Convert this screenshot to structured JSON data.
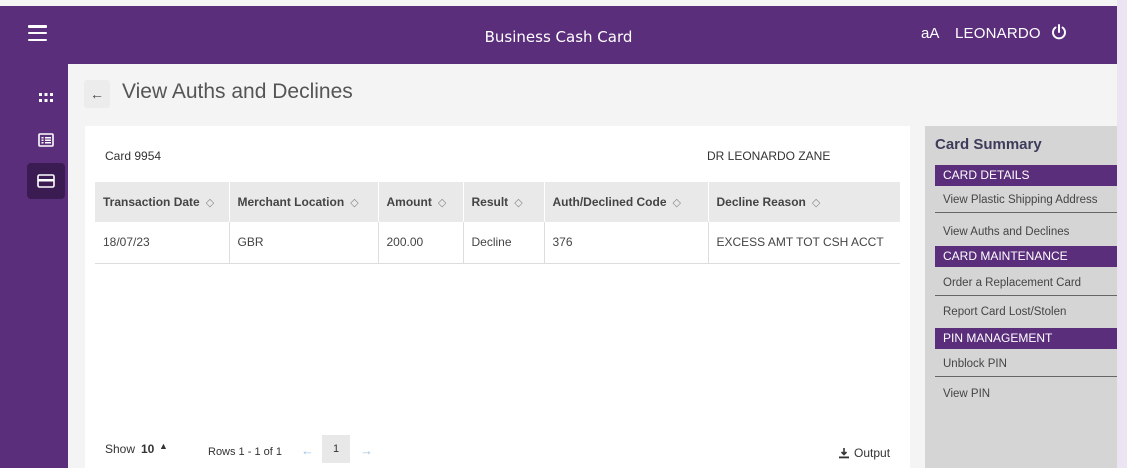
{
  "header": {
    "app_title": "Business Cash Card",
    "font_size_label": "aA",
    "user": "LEONARDO",
    "icons": [
      "menu-icon",
      "grid-icon",
      "list-icon",
      "card-icon",
      "power-icon"
    ]
  },
  "page": {
    "back_label": "←",
    "title": "View Auths and Declines",
    "card_number": "Card 9954",
    "card_holder": "DR LEONARDO ZANE"
  },
  "table": {
    "columns": [
      "Transaction Date",
      "Merchant Location",
      "Amount",
      "Result",
      "Auth/Declined Code",
      "Decline Reason"
    ],
    "sort_glyph": "◇",
    "rows": [
      [
        "18/07/23",
        "GBR",
        "200.00",
        "Decline",
        "376",
        "EXCESS AMT TOT CSH ACCT"
      ]
    ]
  },
  "footer": {
    "show_label": "Show",
    "show_value": "10",
    "rows_label": "Rows 1 - 1 of 1",
    "current_page": "1",
    "output_label": "Output"
  },
  "summary": {
    "title": "Card Summary",
    "sections": [
      {
        "heading": "CARD DETAILS",
        "links": [
          "View Plastic Shipping Address",
          "View Auths and Declines"
        ]
      },
      {
        "heading": "CARD MAINTENANCE",
        "links": [
          "Order a Replacement Card",
          "Report Card Lost/Stolen"
        ]
      },
      {
        "heading": "PIN MANAGEMENT",
        "links": [
          "Unblock PIN",
          "View PIN"
        ]
      }
    ]
  },
  "colors": {
    "brand": "#5b2e7c",
    "brand_dark": "#3a1b52",
    "pager_arrow": "#9fc4e6"
  }
}
